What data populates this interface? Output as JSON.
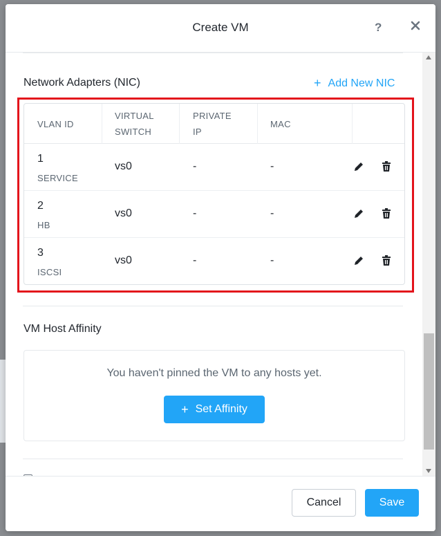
{
  "modal": {
    "title": "Create VM",
    "help_label": "?"
  },
  "nic_section": {
    "title": "Network Adapters (NIC)",
    "add_label": "Add New NIC",
    "columns": [
      "VLAN ID",
      "VIRTUAL SWITCH",
      "PRIVATE IP",
      "MAC"
    ],
    "rows": [
      {
        "vlan_id": "1",
        "vlan_name": "SERVICE",
        "virtual_switch": "vs0",
        "private_ip": "-",
        "mac": "-"
      },
      {
        "vlan_id": "2",
        "vlan_name": "HB",
        "virtual_switch": "vs0",
        "private_ip": "-",
        "mac": "-"
      },
      {
        "vlan_id": "3",
        "vlan_name": "ISCSI",
        "virtual_switch": "vs0",
        "private_ip": "-",
        "mac": "-"
      }
    ]
  },
  "affinity_section": {
    "title": "VM Host Affinity",
    "empty_message": "You haven't pinned the VM to any hosts yet.",
    "set_affinity_label": "Set Affinity"
  },
  "footer": {
    "cancel_label": "Cancel",
    "save_label": "Save"
  },
  "colors": {
    "accent": "#22a5f7",
    "highlight": "#e3131b"
  },
  "icons": [
    "close-icon",
    "plus-icon",
    "pencil-icon",
    "trash-icon"
  ]
}
